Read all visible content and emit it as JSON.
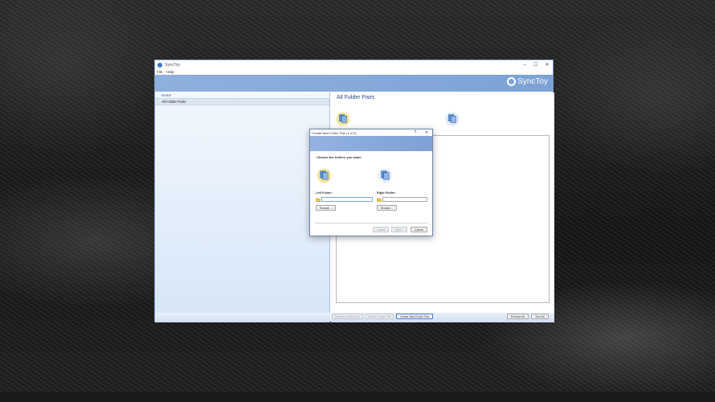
{
  "window": {
    "title": "SyncToy",
    "menu": [
      "File",
      "Help"
    ],
    "logo_text": "SyncToy",
    "controls": {
      "minimize": "–",
      "maximize": "☐",
      "close": "✕"
    }
  },
  "sidebar": {
    "header": "Home",
    "items": [
      {
        "label": "All Folder Pairs"
      }
    ]
  },
  "main": {
    "heading": "All Folder Pairs",
    "buttons": {
      "rename": "Rename Folder Pair",
      "delete": "Delete Folder Pair",
      "create": "Create New Folder Pair",
      "preview_all": "Preview All",
      "run_all": "Run All"
    }
  },
  "dialog": {
    "title": "Create New Folder Pair (1 of 3)",
    "help": "?",
    "close": "✕",
    "prompt": "Choose the folders you want:",
    "left_label": "Left Folder:",
    "right_label": "Right Folder:",
    "left_value": "",
    "right_value": "",
    "browse_left": "Browse...",
    "browse_right": "Browse...",
    "back": "< Back",
    "next": "Next >",
    "cancel": "Cancel"
  },
  "colors": {
    "banner": "#8fb0dd",
    "sidebar": "#e6f0fb",
    "accent": "#2a4f86"
  }
}
